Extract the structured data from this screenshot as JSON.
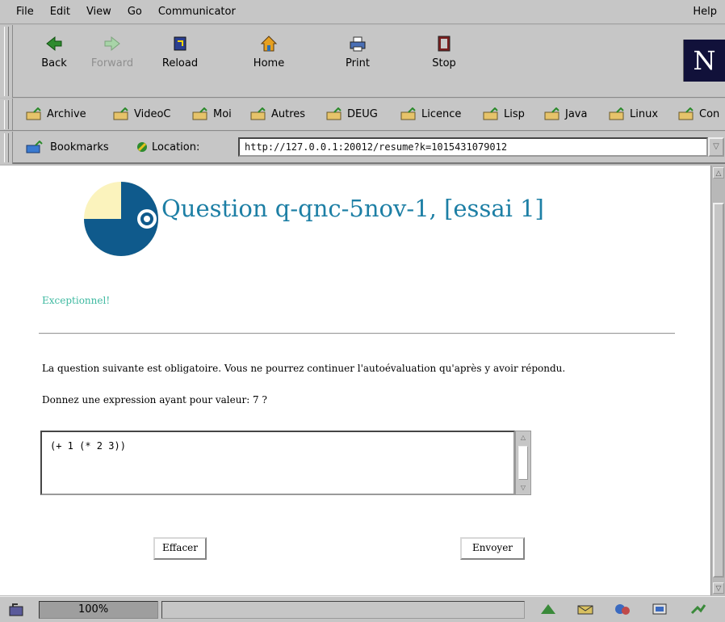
{
  "menu": {
    "items": [
      "File",
      "Edit",
      "View",
      "Go",
      "Communicator"
    ],
    "help": "Help"
  },
  "navigation": {
    "back": "Back",
    "forward": "Forward",
    "reload": "Reload",
    "home": "Home",
    "print": "Print",
    "stop": "Stop",
    "brand_letter": "N"
  },
  "personal_toolbar": {
    "items": [
      "Archive",
      "VideoC",
      "Moi",
      "Autres",
      "DEUG",
      "Licence",
      "Lisp",
      "Java",
      "Linux",
      "Con"
    ]
  },
  "location_bar": {
    "bookmarks_label": "Bookmarks",
    "location_label": "Location:",
    "url": "http://127.0.0.1:20012/resume?k=1015431079012"
  },
  "page": {
    "title": "Question q-qnc-5nov-1, [essai 1]",
    "feedback": "Exceptionnel!",
    "notice": "La question suivante est obligatoire. Vous ne pourrez continuer l'autoévaluation qu'après y avoir répondu.",
    "prompt": "Donnez une expression ayant pour valeur: 7 ?",
    "answer": "(+ 1 (* 2 3))",
    "clear_button": "Effacer",
    "submit_button": "Envoyer"
  },
  "status": {
    "zoom": "100%"
  },
  "colors": {
    "title": "#1d7fa5",
    "feedback": "#3db9a0",
    "logo_blue": "#0f5a8c",
    "logo_yellow": "#fbf3bd"
  }
}
